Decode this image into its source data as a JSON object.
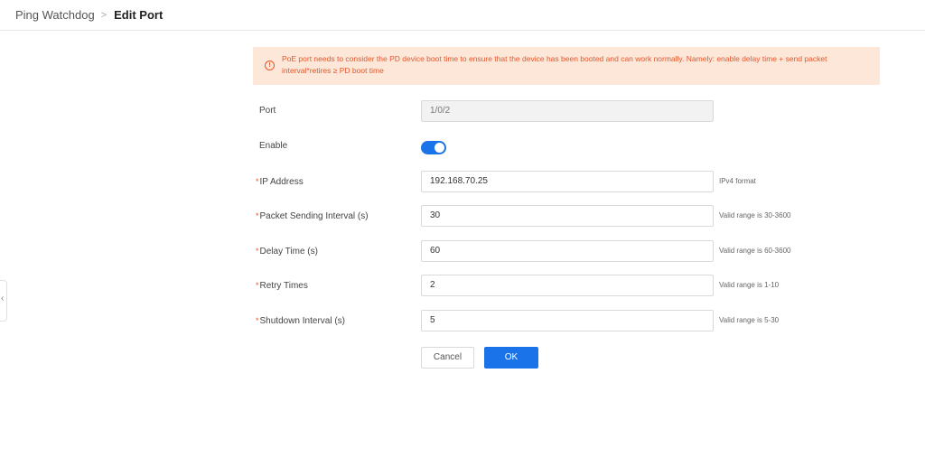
{
  "breadcrumb": {
    "parent": "Ping Watchdog",
    "separator": ">",
    "current": "Edit Port"
  },
  "notice": {
    "icon": "exclamation-circle-icon",
    "text": "PoE port needs to consider the PD device boot time to ensure that the device has been booted and can work normally. Namely: enable delay time + send packet interval*retires ≥ PD boot time"
  },
  "form": {
    "port": {
      "label": "Port",
      "value": "1/0/2"
    },
    "enable": {
      "label": "Enable",
      "on": true
    },
    "ip_address": {
      "label": "IP Address",
      "value": "192.168.70.25",
      "hint": "IPv4 format"
    },
    "packet_interval": {
      "label": "Packet Sending Interval (s)",
      "value": "30",
      "hint": "Valid range is 30-3600"
    },
    "delay_time": {
      "label": "Delay Time (s)",
      "value": "60",
      "hint": "Valid range is 60-3600"
    },
    "retry_times": {
      "label": "Retry Times",
      "value": "2",
      "hint": "Valid range is 1-10"
    },
    "shutdown_interval": {
      "label": "Shutdown Interval (s)",
      "value": "5",
      "hint": "Valid range is 5-30"
    },
    "required_mark": "*"
  },
  "buttons": {
    "cancel": "Cancel",
    "ok": "OK"
  },
  "colors": {
    "accent": "#1a73e8",
    "warning_text": "#e4572e",
    "warning_bg": "#fde7d8"
  }
}
